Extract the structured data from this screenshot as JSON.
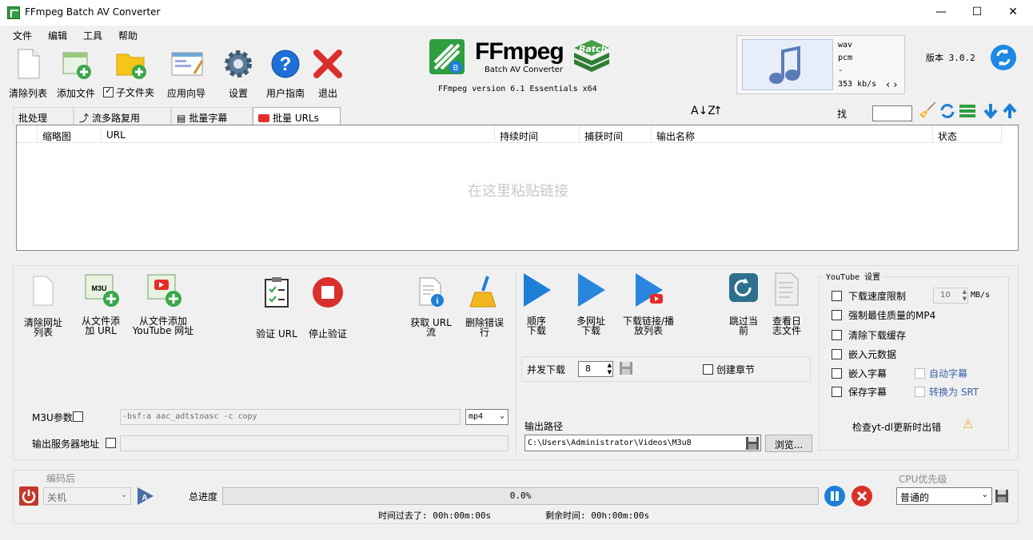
{
  "window": {
    "title": "FFmpeg Batch AV Converter",
    "minimize": "—",
    "maximize": "☐",
    "close": "✕"
  },
  "menu": [
    "文件",
    "编辑",
    "工具",
    "帮助"
  ],
  "toolbar": {
    "clear_list": "清除列表",
    "add_files": "添加文件",
    "subfolders": "子文件夹",
    "wizard": "应用向导",
    "settings": "设置",
    "user_guide": "用户指南",
    "exit": "退出"
  },
  "logo": {
    "title": "FFmpeg",
    "subtitle": "Batch AV Converter",
    "badge": "Batch",
    "version_line": "FFmpeg version 6.1 Essentials  x64"
  },
  "media_info": {
    "format": "wav",
    "codec": "pcm",
    "dash": "-",
    "bitrate": "353 kb/s",
    "nav": "‹ ›"
  },
  "app_version": "版本 3.0.2",
  "tabs": [
    "批处理",
    "流多路复用",
    "批量字幕",
    "批量 URLs"
  ],
  "search": {
    "label": "找",
    "value": ""
  },
  "grid": {
    "columns": [
      "",
      "缩略图",
      "URL",
      "持续时间",
      "捕获时间",
      "输出名称",
      "状态"
    ],
    "placeholder": "在这里粘贴链接"
  },
  "url_panel": {
    "clear_urls": [
      "清除网址",
      "列表"
    ],
    "add_from_file": [
      "从文件添",
      "加 URL"
    ],
    "add_youtube": [
      "从文件添加",
      "YouTube 网址"
    ],
    "validate": "验证 URL",
    "stop_validate": "停止验证",
    "get_stream": [
      "获取 URL",
      "流"
    ],
    "delete_errors": [
      "删除错误",
      "行"
    ],
    "m3u_label": "M3U参数",
    "m3u_params": "-bsf:a aac_adtstoasc -c copy",
    "m3u_format": "mp4",
    "output_server_label": "输出服务器地址",
    "output_server_value": ""
  },
  "download_panel": {
    "sequential": [
      "顺序",
      "下载"
    ],
    "multi": [
      "多网址",
      "下载"
    ],
    "playlist": [
      "下载链接/播",
      "放列表"
    ],
    "skip": [
      "跳过当",
      "前"
    ],
    "log": [
      "查看日",
      "志文件"
    ],
    "concurrent_label": "并发下载",
    "concurrent_value": "8",
    "create_chapters": "创建章节",
    "output_path_label": "输出路径",
    "output_path": "C:\\Users\\Administrator\\Videos\\M3u8",
    "browse": "浏览..."
  },
  "youtube": {
    "title": "YouTube 设置",
    "speed_limit": "下载速度限制",
    "speed_value": "10",
    "speed_unit": "MB/s",
    "force_mp4": "强制最佳质量的MP4",
    "clear_cache": "清除下载缓存",
    "embed_meta": "嵌入元数据",
    "embed_subs": "嵌入字幕",
    "auto_subs": "自动字幕",
    "save_subs": "保存字幕",
    "to_srt": "转换为 SRT",
    "check_update": "检查yt-dl更新时出错",
    "warning_icon": "⚠"
  },
  "footer": {
    "after_encode_label": "编码后",
    "after_encode_value": "关机",
    "total_progress_label": "总进度",
    "progress_percent": 0,
    "progress_text": "0.0%",
    "elapsed": "时间过去了: 00h:00m:00s",
    "remaining": "剩余时间: 00h:00m:00s",
    "cpu_label": "CPU优先级",
    "cpu_value": "普通的"
  },
  "colors": {
    "accent_blue": "#1e7fd6",
    "ffmpeg_green": "#2e9e3e",
    "red": "#d9302c"
  }
}
